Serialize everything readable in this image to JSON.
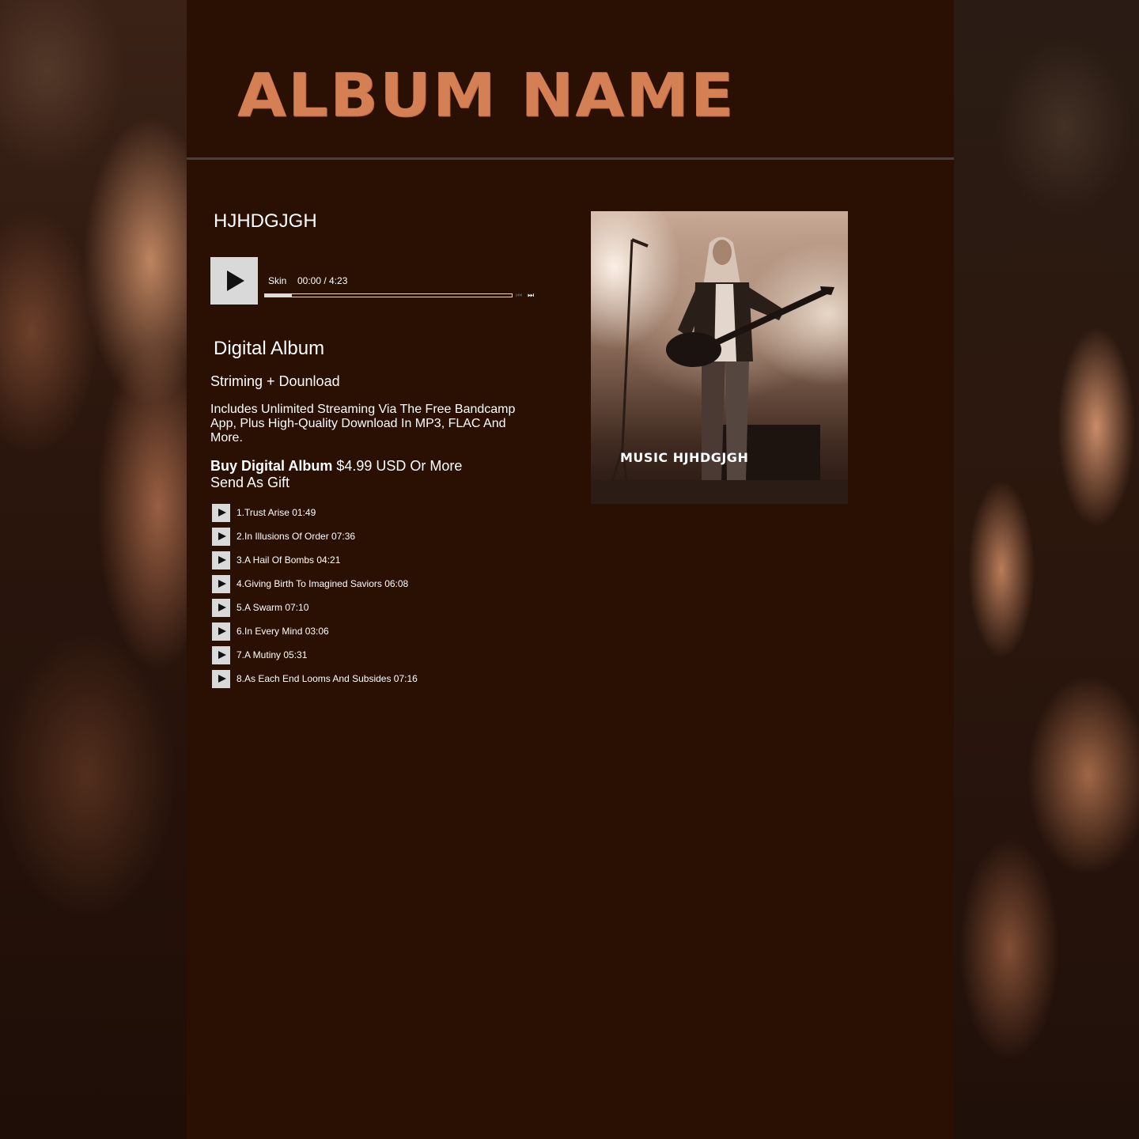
{
  "header": {
    "title": "ALBUM NAME"
  },
  "artist": {
    "name": "HJHDGJGH"
  },
  "player": {
    "track_name": "Skin",
    "time": "00:00 / 4:23",
    "progress": 0.11,
    "prev_icon": "⏮",
    "next_icon": "⏭"
  },
  "product": {
    "title": "Digital Album",
    "subtitle": "Striming + Dounload",
    "description": "Includes Unlimited Streaming Via The Free Bandcamp App, Plus High-Quality Download In MP3, FLAC And More.",
    "buy_label": "Buy Digital Album",
    "price": "$4.99 USD Or More",
    "gift_label": "Send As Gift"
  },
  "tracks": [
    {
      "label": "1.Trust Arise  01:49"
    },
    {
      "label": "2.In Illusions Of Order  07:36"
    },
    {
      "label": "3.A Hail Of Bombs  04:21"
    },
    {
      "label": "4.Giving Birth To Imagined Saviors  06:08"
    },
    {
      "label": "5.A Swarm  07:10"
    },
    {
      "label": "6.In Every Mind  03:06"
    },
    {
      "label": "7.A Mutiny  05:31"
    },
    {
      "label": "8.As Each End Looms And Subsides  07:16"
    }
  ],
  "cover": {
    "caption": "MUSIC HJHDGJGH"
  },
  "colors": {
    "accent": "#d57f54",
    "panel": "#2a0f03",
    "rule": "#444040"
  }
}
